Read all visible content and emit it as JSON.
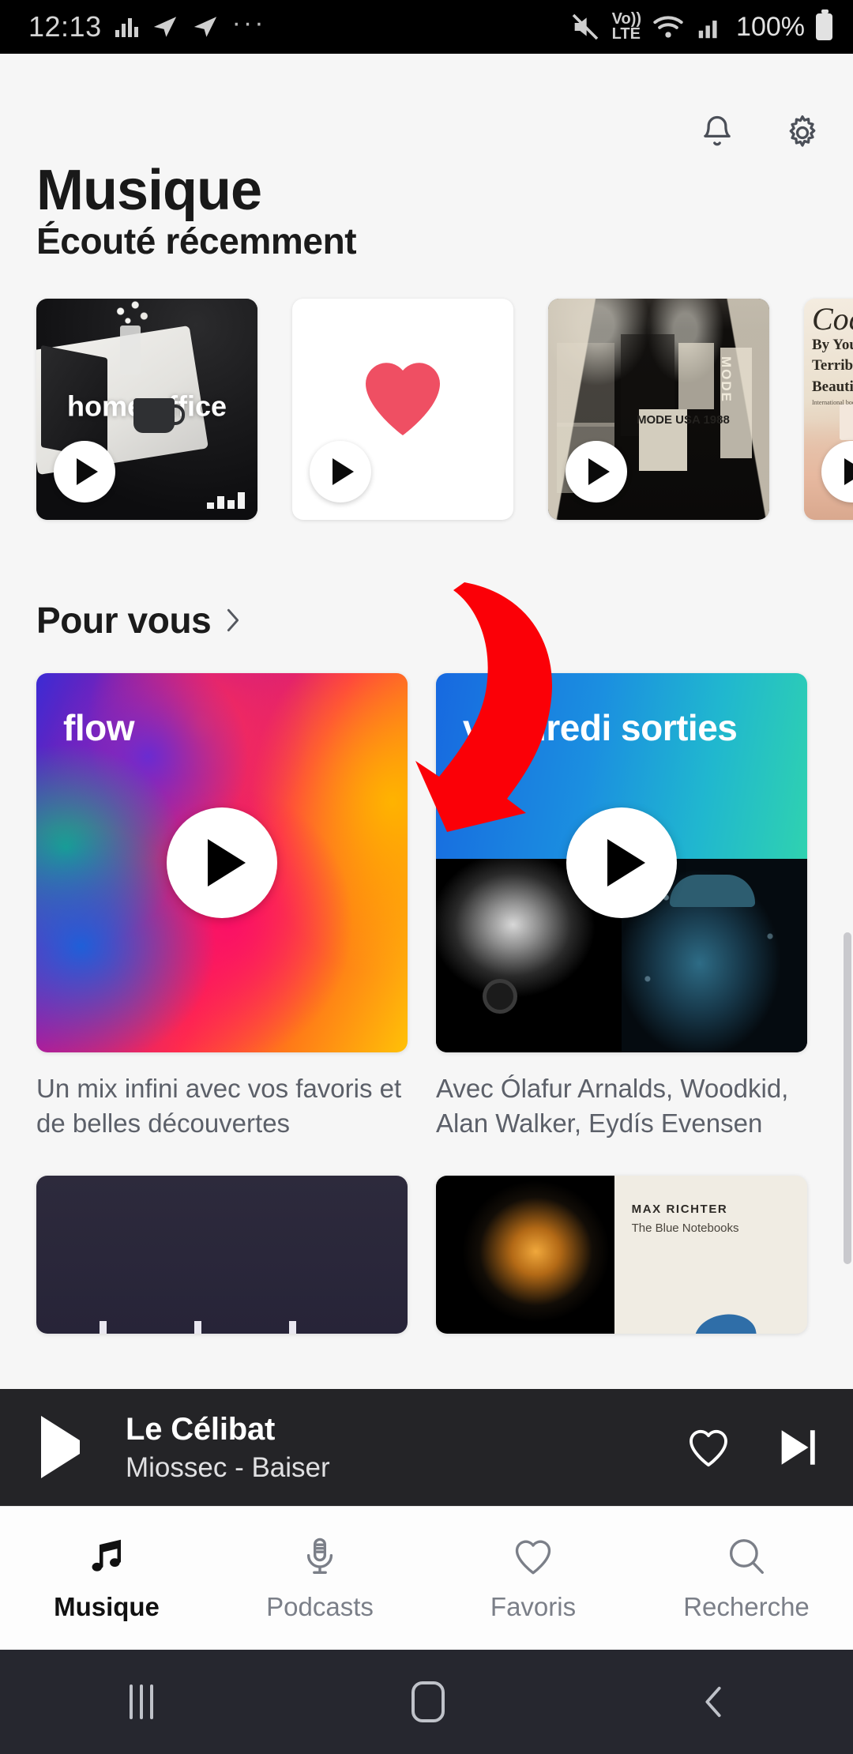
{
  "status_bar": {
    "time": "12:13",
    "icons_left": [
      "equalizer-icon",
      "telegram-icon",
      "telegram-icon",
      "more-icon"
    ],
    "icons_right": [
      "mute-icon",
      "volte-icon",
      "wifi-icon",
      "signal-icon"
    ],
    "volte_top": "Vo))",
    "volte_bottom": "LTE",
    "battery_percent": "100%"
  },
  "header": {
    "title": "Musique",
    "notifications_icon": "bell-icon",
    "settings_icon": "gear-icon"
  },
  "recently_played": {
    "section_title": "Écouté récemment",
    "cards": [
      {
        "label": "home office",
        "art": "home-office-photo",
        "play_icon": "play-icon"
      },
      {
        "label": "",
        "art": "favourites-heart",
        "play_icon": "play-icon"
      },
      {
        "label": "",
        "art": "depeche-mode-poster-wall",
        "play_icon": "play-icon"
      },
      {
        "label": "",
        "art": "coco-book-cover",
        "play_icon": "play-icon"
      }
    ],
    "coco_line1": "Coco",
    "coco_line2": "By You",
    "coco_line3": "Terrible",
    "coco_line4": "Beautiful",
    "coco_line5": "International book",
    "poster_mode": "MODE",
    "poster_usa": "MODE USA 1988"
  },
  "for_you": {
    "section_title": "Pour vous",
    "chevron_icon": "chevron-right-icon",
    "cards": [
      {
        "title": "flow",
        "description": "Un mix infini avec vos favoris et de belles découvertes",
        "play_icon": "play-icon",
        "art": "flow-rainbow-gradient"
      },
      {
        "title": "vendredi sorties",
        "description": "Avec Ólafur Arnalds, Woodkid, Alan Walker, Eydís Evensen",
        "play_icon": "play-icon",
        "art": "blue-teal-gradient-with-artist-photos"
      }
    ],
    "next_row": [
      {
        "art": "dark-navy-card",
        "title": ""
      },
      {
        "art": "max-richter-blue-notebooks",
        "artist": "MAX RICHTER",
        "album": "The Blue Notebooks"
      }
    ]
  },
  "annotation": {
    "arrow_color": "#fb0007",
    "shape": "curved-down-left-arrow"
  },
  "mini_player": {
    "play_icon": "play-icon",
    "track_title": "Le Célibat",
    "track_subtitle": "Miossec - Baiser",
    "favourite_icon": "heart-outline-icon",
    "next_icon": "skip-next-icon"
  },
  "bottom_nav": {
    "items": [
      {
        "label": "Musique",
        "icon": "music-note-icon",
        "active": true
      },
      {
        "label": "Podcasts",
        "icon": "microphone-icon",
        "active": false
      },
      {
        "label": "Favoris",
        "icon": "heart-outline-icon",
        "active": false
      },
      {
        "label": "Recherche",
        "icon": "search-icon",
        "active": false
      }
    ]
  },
  "android_nav": {
    "recents_icon": "recents-icon",
    "home_icon": "home-icon",
    "back_icon": "back-icon"
  },
  "colors": {
    "accent_red": "#ef4f63",
    "annotation_red": "#fb0007",
    "background": "#f6f6f6",
    "player_bg": "#242427",
    "nav_bg": "#26272f"
  }
}
